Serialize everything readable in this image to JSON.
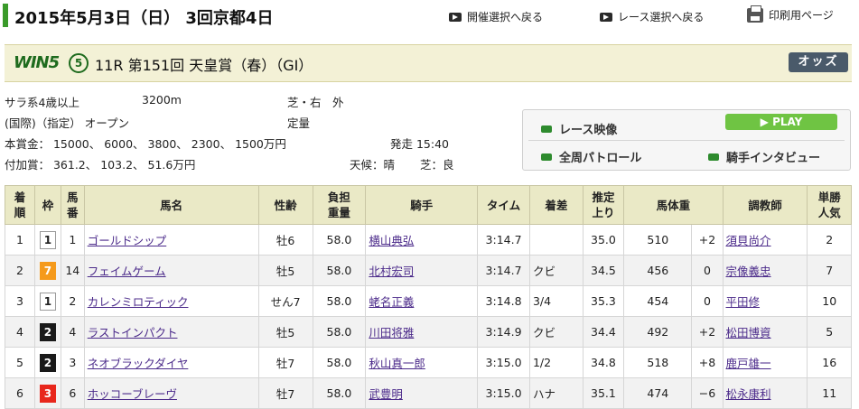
{
  "header": {
    "title": "2015年5月3日（日） 3回京都4日",
    "nav_meeting": "開催選択へ戻る",
    "nav_race": "レース選択へ戻る",
    "nav_print": "印刷用ページ"
  },
  "race": {
    "win5_logo": "WIN5",
    "win5_number": "5",
    "name": "11R 第151回 天皇賞（春）（GI）",
    "odds_button": "オッズ"
  },
  "info": {
    "class": "サラ系4歳以上",
    "distance": "3200m",
    "course": "芝・右　外",
    "conditions": "(国際)（指定） オープン",
    "weight_rule": "定量",
    "prize": "本賞金：  15000、 6000、 3800、 2300、 1500万円",
    "start": "発走 15:40",
    "added_prize": "付加賞：  361.2、 103.2、  51.6万円",
    "weather": "天候：晴",
    "going": "芝：良"
  },
  "media": {
    "race_video": "レース映像",
    "play": "PLAY",
    "patrol": "全周パトロール",
    "interview": "騎手インタビュー"
  },
  "columns": [
    "着\n順",
    "枠",
    "馬\n番",
    "馬名",
    "性齢",
    "負担\n重量",
    "騎手",
    "タイム",
    "着差",
    "推定\n上り",
    "馬体重",
    "",
    "調教師",
    "単勝\n人気"
  ],
  "rows": [
    {
      "pos": "1",
      "waku": "1",
      "num": "1",
      "horse": "ゴールドシップ",
      "sexage": "牡6",
      "weight": "58.0",
      "jockey": "横山典弘",
      "time": "3:14.7",
      "margin": "",
      "last": "35.0",
      "bw": "510",
      "diff": "+2",
      "trainer": "須貝尚介",
      "pop": "2"
    },
    {
      "pos": "2",
      "waku": "7",
      "num": "14",
      "horse": "フェイムゲーム",
      "sexage": "牡5",
      "weight": "58.0",
      "jockey": "北村宏司",
      "time": "3:14.7",
      "margin": "クビ",
      "last": "34.5",
      "bw": "456",
      "diff": "0",
      "trainer": "宗像義忠",
      "pop": "7"
    },
    {
      "pos": "3",
      "waku": "1",
      "num": "2",
      "horse": "カレンミロティック",
      "sexage": "せん7",
      "weight": "58.0",
      "jockey": "蛯名正義",
      "time": "3:14.8",
      "margin": "3/4",
      "last": "35.3",
      "bw": "454",
      "diff": "0",
      "trainer": "平田修",
      "pop": "10"
    },
    {
      "pos": "4",
      "waku": "2",
      "num": "4",
      "horse": "ラストインパクト",
      "sexage": "牡5",
      "weight": "58.0",
      "jockey": "川田将雅",
      "time": "3:14.9",
      "margin": "クビ",
      "last": "34.4",
      "bw": "492",
      "diff": "+2",
      "trainer": "松田博資",
      "pop": "5"
    },
    {
      "pos": "5",
      "waku": "2",
      "num": "3",
      "horse": "ネオブラックダイヤ",
      "sexage": "牡7",
      "weight": "58.0",
      "jockey": "秋山真一郎",
      "time": "3:15.0",
      "margin": "1/2",
      "last": "34.8",
      "bw": "518",
      "diff": "+8",
      "trainer": "鹿戸雄一",
      "pop": "16"
    },
    {
      "pos": "6",
      "waku": "3",
      "num": "6",
      "horse": "ホッコーブレーヴ",
      "sexage": "牡7",
      "weight": "58.0",
      "jockey": "武豊明",
      "time": "3:15.0",
      "margin": "ハナ",
      "last": "35.1",
      "bw": "474",
      "diff": "−6",
      "trainer": "松永康利",
      "pop": "11"
    }
  ],
  "waku_colors": {
    "1": {
      "bg": "#ffffff",
      "fg": "#222222",
      "border": "#999999"
    },
    "2": {
      "bg": "#1a1a1a",
      "fg": "#ffffff",
      "border": "#1a1a1a"
    },
    "3": {
      "bg": "#e8271c",
      "fg": "#ffffff",
      "border": "#e8271c"
    },
    "7": {
      "bg": "#f59a1b",
      "fg": "#ffffff",
      "border": "#f59a1b"
    }
  }
}
